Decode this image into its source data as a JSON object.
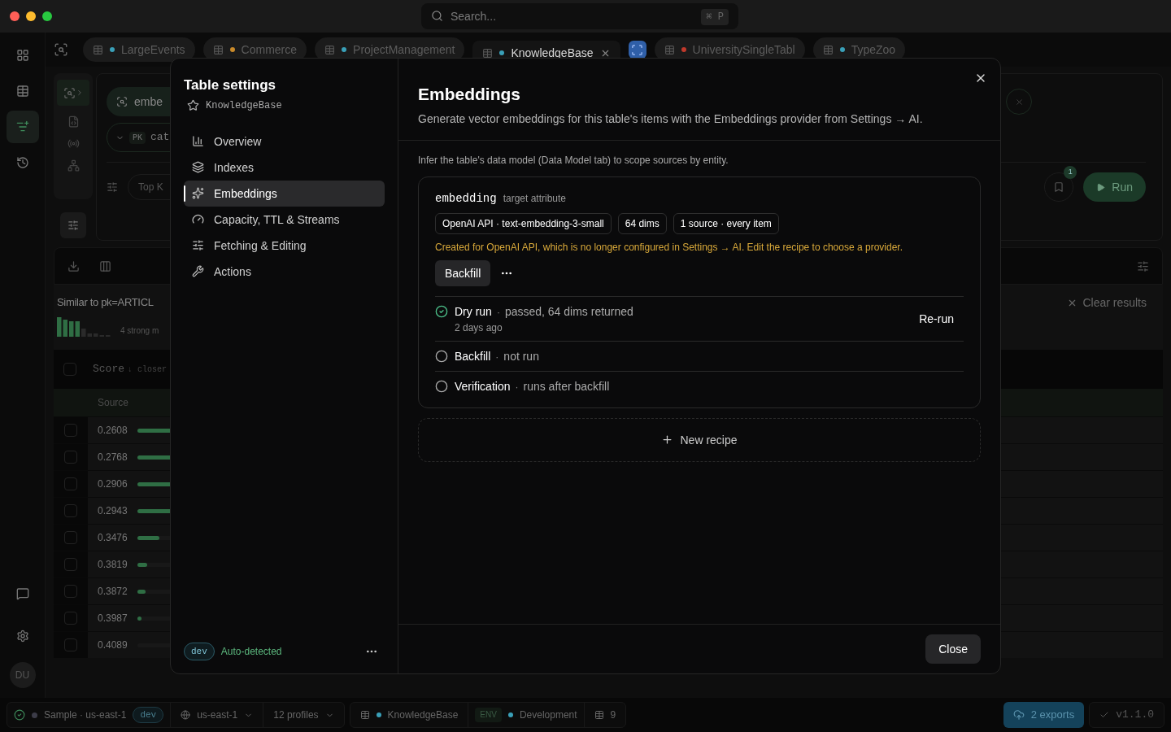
{
  "window": {
    "search": {
      "placeholder": "Search...",
      "shortcut": "⌘ P"
    }
  },
  "rail": [
    {
      "selected": false
    },
    {
      "selected": false
    },
    {
      "selected": true
    },
    {
      "selected": false
    }
  ],
  "rail_bottom": {
    "avatar": "DU"
  },
  "tabs": [
    {
      "label": "LargeEvents",
      "color": "#3aa0b8",
      "selected": false,
      "kind": "table"
    },
    {
      "label": "Commerce",
      "color": "#c98a2a",
      "selected": false,
      "kind": "table"
    },
    {
      "label": "ProjectManagement",
      "color": "#3aa0b8",
      "selected": false,
      "kind": "table"
    },
    {
      "label": "KnowledgeBase",
      "color": "#3aa0b8",
      "selected": true,
      "kind": "table"
    },
    {
      "kind": "action"
    },
    {
      "label": "UniversitySingleTabl",
      "color": "#c0392b",
      "selected": false,
      "kind": "table"
    },
    {
      "label": "TypeZoo",
      "color": "#3aa0b8",
      "selected": false,
      "kind": "table"
    }
  ],
  "query": {
    "chip": "embe",
    "pk_label": "PK",
    "pk_value": "cat",
    "topk_label": "Top K",
    "bookmark_count": "1",
    "run": "Run"
  },
  "results": {
    "title": "Similar to pk=ARTICL",
    "summary": "4 strong m",
    "clear": "Clear results",
    "score_header": "Score",
    "sort_hint": "↓ closer",
    "all_checked": false,
    "source_header": "Source",
    "rows": [
      {
        "score": "0.2608",
        "level": 0.7,
        "checked": false
      },
      {
        "score": "0.2768",
        "level": 0.58,
        "checked": false
      },
      {
        "score": "0.2906",
        "level": 0.52,
        "checked": false
      },
      {
        "score": "0.2943",
        "level": 0.48,
        "checked": false
      },
      {
        "score": "0.3476",
        "level": 0.27,
        "checked": false
      },
      {
        "score": "0.3819",
        "level": 0.12,
        "checked": false
      },
      {
        "score": "0.3872",
        "level": 0.1,
        "checked": false
      },
      {
        "score": "0.3987",
        "level": 0.05,
        "checked": false
      },
      {
        "score": "0.4089",
        "level": 0,
        "checked": false
      }
    ]
  },
  "modal": {
    "title": "Table settings",
    "table": "KnowledgeBase",
    "nav": [
      {
        "label": "Overview",
        "selected": false
      },
      {
        "label": "Indexes",
        "selected": false
      },
      {
        "label": "Embeddings",
        "selected": true
      },
      {
        "label": "Capacity, TTL & Streams",
        "selected": false
      },
      {
        "label": "Fetching & Editing",
        "selected": false
      },
      {
        "label": "Actions",
        "selected": false
      }
    ],
    "env_badge": "dev",
    "env_status": "Auto-detected",
    "heading": "Embeddings",
    "description": "Generate vector embeddings for this table's items with the Embeddings provider from Settings → AI.",
    "hint": "Infer the table's data model (Data Model tab) to scope sources by entity.",
    "recipe": {
      "attribute": "embedding",
      "attribute_note": "target attribute",
      "tags": [
        "OpenAI API · text-embedding-3-small",
        "64 dims",
        "1 source · every item"
      ],
      "warning": "Created for OpenAI API, which is no longer configured in Settings → AI. Edit the recipe to choose a provider.",
      "primary_action": "Backfill",
      "steps": [
        {
          "name": "Dry run",
          "separator": "·",
          "detail": "passed, 64 dims returned",
          "time": "2 days ago",
          "passed": true,
          "action": "Re-run"
        },
        {
          "name": "Backfill",
          "separator": "·",
          "detail": "not run",
          "passed": false
        },
        {
          "name": "Verification",
          "separator": "·",
          "detail": "runs after backfill",
          "passed": false
        }
      ]
    },
    "new_recipe": "New recipe",
    "close": "Close"
  },
  "status_bar": {
    "connection": "Sample · us-east-1",
    "connection_badge": "dev",
    "region": "us-east-1",
    "profiles": "12 profiles",
    "table": "KnowledgeBase",
    "env_label": "ENV",
    "env": "Development",
    "count": "9",
    "exports": "2 exports",
    "version": "v1.1.0"
  }
}
